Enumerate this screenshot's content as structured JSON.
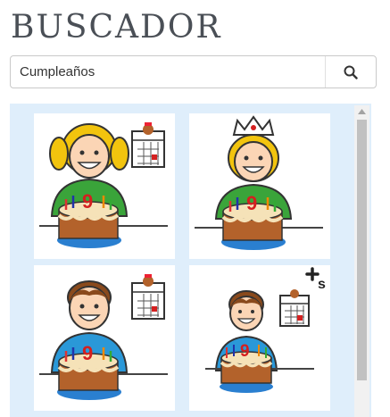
{
  "header": {
    "title": "BUSCADOR"
  },
  "search": {
    "value": "Cumpleaños",
    "button_icon": "search-icon"
  },
  "results": {
    "items": [
      {
        "name": "pictogram-girl-birthday",
        "icon": "girl-birthday-cake-icon"
      },
      {
        "name": "pictogram-girl-crown-birthday",
        "icon": "girl-crown-birthday-cake-icon"
      },
      {
        "name": "pictogram-boy-birthday",
        "icon": "boy-birthday-cake-icon"
      },
      {
        "name": "pictogram-boy-birthday-plural",
        "icon": "boy-birthday-plural-icon",
        "badge": "+s"
      }
    ]
  },
  "colors": {
    "results_background": "#dfeefb",
    "shirt_girl": "#3aa43a",
    "shirt_boy": "#2a98d8",
    "cake": "#b3622b",
    "plate": "#2a7fd0"
  }
}
